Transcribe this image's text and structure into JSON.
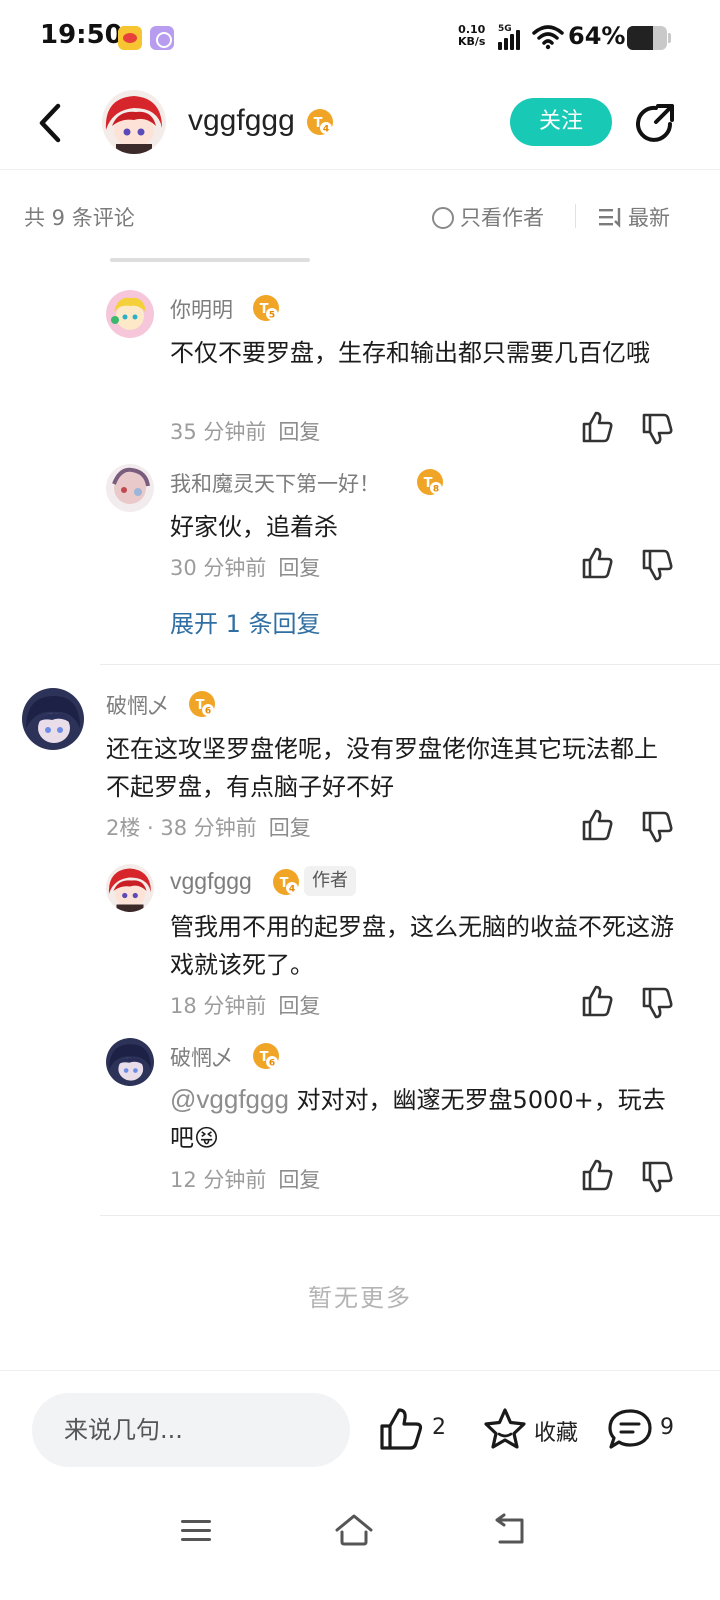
{
  "status_bar": {
    "time": "19:50",
    "net_speed_value": "0.10",
    "net_speed_unit": "KB/s",
    "network_type": "5G",
    "battery_pct": "64%",
    "battery_level": 0.64
  },
  "header": {
    "username": "vggfggg",
    "level": "4",
    "follow_label": "关注"
  },
  "filter": {
    "count_label": "共 9 条评论",
    "author_only_label": "只看作者",
    "sort_label": "最新"
  },
  "comments": {
    "r1": {
      "user": "你明明",
      "level": "5",
      "text": "不仅不要罗盘，生存和输出都只需要几百亿哦",
      "time": "35 分钟前",
      "reply_label": "回复"
    },
    "r2": {
      "user": "我和魔灵天下第一好！",
      "level": "8",
      "text": "好家伙，追着杀",
      "time": "30 分钟前",
      "reply_label": "回复"
    },
    "expand_label": "展开 1 条回复",
    "c2": {
      "user": "破惘乄",
      "level": "6",
      "text": "还在这攻坚罗盘佬呢，没有罗盘佬你连其它玩法都上不起罗盘，有点脑子好不好",
      "floor_time": "2楼 · 38 分钟前",
      "reply_label": "回复"
    },
    "r3": {
      "user": "vggfggg",
      "level": "4",
      "author_tag": "作者",
      "text": "管我用不用的起罗盘，这么无脑的收益不死这游戏就该死了。",
      "time": "18 分钟前",
      "reply_label": "回复"
    },
    "r4": {
      "user": "破惘乄",
      "level": "6",
      "mention": "@vggfggg",
      "text": " 对对对，幽邃无罗盘5000+，玩去吧😝",
      "time": "12 分钟前",
      "reply_label": "回复"
    }
  },
  "no_more_label": "暂无更多",
  "bottom_bar": {
    "input_placeholder": "来说几句...",
    "like_count": "2",
    "favorite_label": "收藏",
    "comment_count": "9"
  },
  "colors": {
    "accent": "#18c9b6",
    "link": "#2f6fa3",
    "level_badge": "#f0a526"
  }
}
